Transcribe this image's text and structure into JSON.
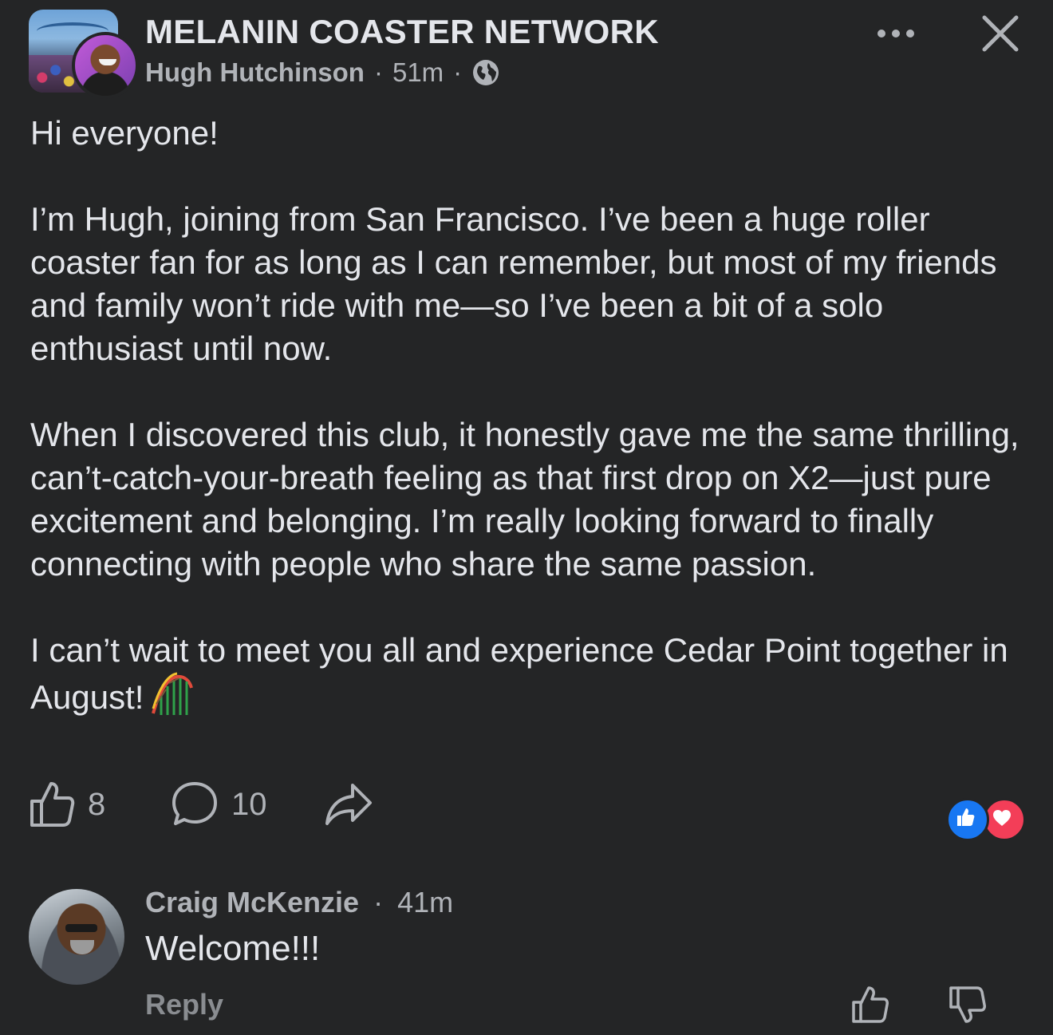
{
  "header": {
    "group_name": "MELANIN COASTER NETWORK",
    "author": "Hugh Hutchinson",
    "separator": "·",
    "time": "51m",
    "visibility_icon": "globe-icon",
    "more_icon": "more-dots-icon",
    "close_icon": "close-icon"
  },
  "post": {
    "paragraphs": [
      "Hi everyone!",
      "I’m Hugh, joining from San Francisco. I’ve been a huge roller coaster fan for as long as I can remember, but most of my friends and family won’t ride with me—so I’ve been a bit of a solo enthusiast until now.",
      "When I discovered this club, it honestly gave me the same thrilling, can’t-catch-your-breath feeling as that first drop on X2—just pure excitement and belonging. I’m really looking forward to finally connecting with people who share the same passion.",
      "I can’t wait to meet you all and experience Cedar Point together in August!"
    ],
    "emoji": "roller-coaster-emoji"
  },
  "actions": {
    "like_count": "8",
    "comment_count": "10",
    "reactions": [
      "like",
      "love"
    ]
  },
  "comment": {
    "author": "Craig McKenzie",
    "separator": "·",
    "time": "41m",
    "text": "Welcome!!!",
    "reply_label": "Reply"
  },
  "colors": {
    "background": "#242526",
    "text_primary": "#e4e6eb",
    "text_secondary": "#b0b3b8",
    "like_blue": "#1877f2",
    "love_red": "#f33e58"
  }
}
